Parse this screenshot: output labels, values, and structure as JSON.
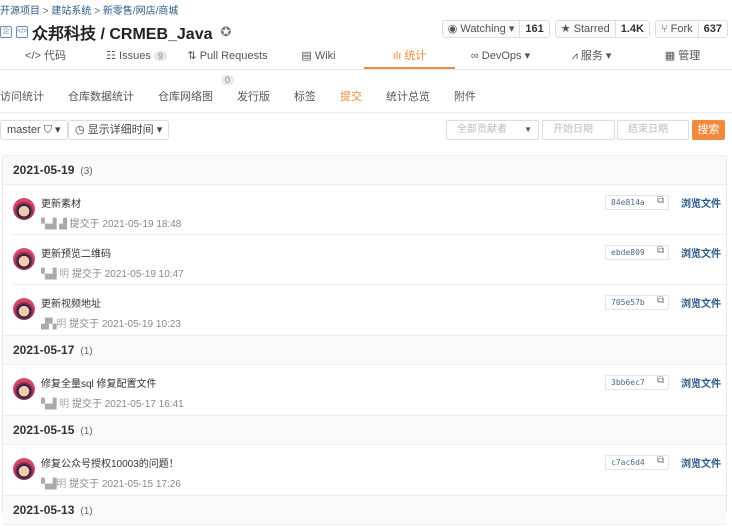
{
  "breadcrumb": {
    "items": [
      "开源项目",
      "建站系统",
      "新零售/网店/商城"
    ],
    "sep": ">"
  },
  "repo": {
    "title": "众邦科技 / CRMEB_Java"
  },
  "actions": {
    "watch": "Watching ▾",
    "watch_count": "161",
    "star": "★ Starred",
    "star_count": "1.4K",
    "fork": "Fork",
    "fork_count": "637"
  },
  "nav": [
    {
      "label": "</> 代码"
    },
    {
      "label": "Issues",
      "badge": "9"
    },
    {
      "label": "Pull Requests",
      "badge": "0"
    },
    {
      "label": "Wiki"
    },
    {
      "label": "统计"
    },
    {
      "label": "DevOps ▾"
    },
    {
      "label": "服务 ▾"
    },
    {
      "label": "管理"
    }
  ],
  "subnav": [
    "访问统计",
    "仓库数据统计",
    "仓库网络图",
    "发行版",
    "标签",
    "提交",
    "统计总览",
    "附件"
  ],
  "toolbar": {
    "branch": "master",
    "time_toggle": "显示详细时间",
    "contributor": "全部贡献者",
    "start_date": "开始日期",
    "end_date": "结束日期",
    "search": "搜索"
  },
  "groups": [
    {
      "date": "2021-05-19",
      "count": "(3)",
      "commits": [
        {
          "msg": "更新素材",
          "author": "▚▟ ▟",
          "time": "提交于 2021-05-19 18:48",
          "sha": "84e814a"
        },
        {
          "msg": "更新预览二维码",
          "author": "▚▟ 明",
          "time": "提交于 2021-05-19 10:47",
          "sha": "ebde809"
        },
        {
          "msg": "更新视频地址",
          "author": "▟▚明",
          "time": "提交于 2021-05-19 10:23",
          "sha": "705e57b"
        }
      ]
    },
    {
      "date": "2021-05-17",
      "count": "(1)",
      "commits": [
        {
          "msg": "修复全量sql 修复配置文件",
          "author": "▚▟ 明",
          "time": "提交于 2021-05-17 16:41",
          "sha": "3bb6ec7"
        }
      ]
    },
    {
      "date": "2021-05-15",
      "count": "(1)",
      "commits": [
        {
          "msg": "修复公众号授权10003的问题！",
          "author": "▚▟明",
          "time": "提交于 2021-05-15 17:26",
          "sha": "c7ac6d4"
        }
      ]
    },
    {
      "date": "2021-05-13",
      "count": "(1)",
      "commits": []
    }
  ],
  "browse_label": "浏览文件"
}
